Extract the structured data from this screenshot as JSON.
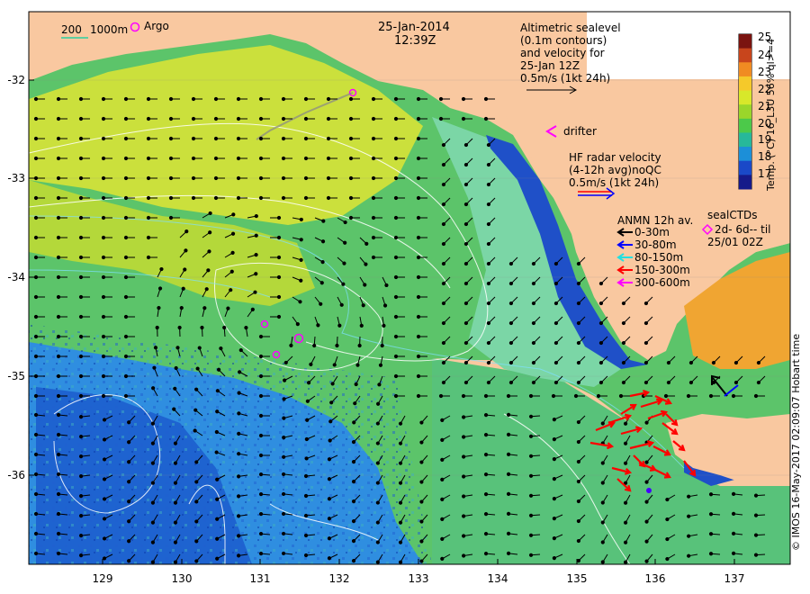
{
  "header": {
    "date": "25-Jan-2014",
    "time": "12:39Z"
  },
  "scale_bar": {
    "label_200": "200",
    "label_1000": "1000m"
  },
  "legend": {
    "argo_label": "Argo",
    "altimetry": [
      "Altimetric sealevel",
      "(0.1m contours)",
      "and velocity for",
      "25-Jan 12Z",
      "0.5m/s (1kt 24h)"
    ],
    "drifter_label": "drifter",
    "hf_radar": [
      "HF radar velocity",
      "(4-12h avg)noQC",
      "0.5m/s (1kt 24h)"
    ],
    "anmn_title": "ANMN 12h av.",
    "anmn_items": [
      {
        "label": "0-30m",
        "color": "#000000"
      },
      {
        "label": "30-80m",
        "color": "#0000ff"
      },
      {
        "label": "80-150m",
        "color": "#22e0e0"
      },
      {
        "label": "150-300m",
        "color": "#ff0000"
      },
      {
        "label": "300-600m",
        "color": "#ff00ff"
      }
    ],
    "seal_ctds": [
      "sealCTDs",
      "2d- 6d-- til",
      "25/01 02Z"
    ]
  },
  "axes": {
    "y_ticks": [
      "-32",
      "-33",
      "-34",
      "-35",
      "-36"
    ],
    "x_ticks": [
      "129",
      "130",
      "131",
      "132",
      "133",
      "134",
      "135",
      "136",
      "137"
    ]
  },
  "colorbar": {
    "ticks": [
      "25",
      "24",
      "23",
      "22",
      "21",
      "20",
      "19",
      "18",
      "17"
    ],
    "title": "Temp. (°C) 16_L3U 56% ql>=4",
    "colors": [
      "#7a1410",
      "#c8451c",
      "#f08b22",
      "#f5c92a",
      "#d8e82a",
      "#9ad62a",
      "#4cc94a",
      "#27b89a",
      "#1c8fd8",
      "#1a49c8",
      "#161a8a"
    ]
  },
  "credit": "© IMOS 16-May-2017 02:09:07 Hobart time"
}
